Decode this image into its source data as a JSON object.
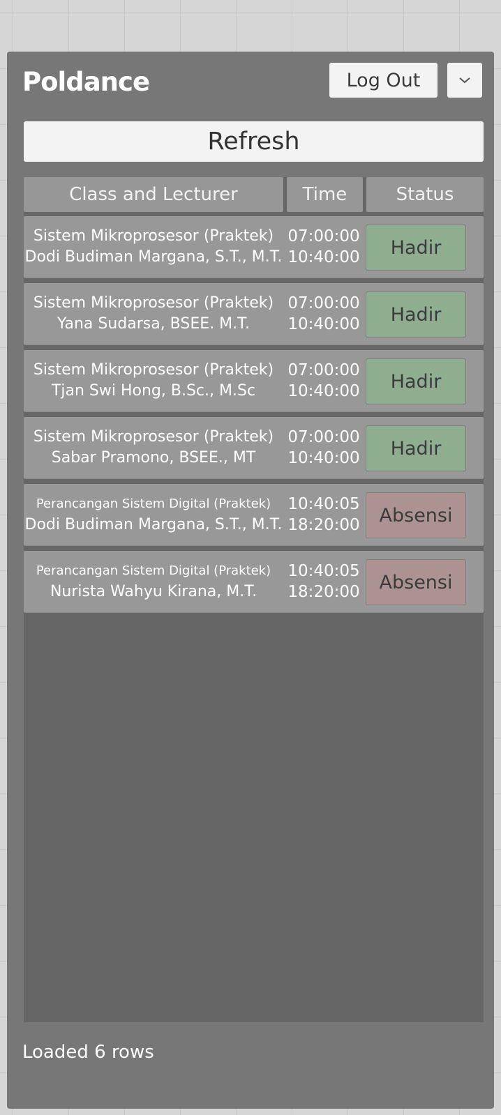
{
  "app": {
    "title": "Poldance"
  },
  "header": {
    "logout_label": "Log Out",
    "dropdown_icon": "chevron-down-icon"
  },
  "toolbar": {
    "refresh_label": "Refresh"
  },
  "table": {
    "columns": [
      "Class and Lecturer",
      "Time",
      "Status"
    ],
    "rows": [
      {
        "class": "Sistem Mikroprosesor (Praktek)",
        "lecturer": "Dodi Budiman Margana, S.T., M.T.",
        "start": "07:00:00",
        "end": "10:40:00",
        "status": "Hadir",
        "status_color": "#8fae8f"
      },
      {
        "class": "Sistem Mikroprosesor (Praktek)",
        "lecturer": "Yana Sudarsa, BSEE. M.T.",
        "start": "07:00:00",
        "end": "10:40:00",
        "status": "Hadir",
        "status_color": "#8fae8f"
      },
      {
        "class": "Sistem Mikroprosesor (Praktek)",
        "lecturer": "Tjan Swi Hong, B.Sc., M.Sc",
        "start": "07:00:00",
        "end": "10:40:00",
        "status": "Hadir",
        "status_color": "#8fae8f"
      },
      {
        "class": "Sistem Mikroprosesor (Praktek)",
        "lecturer": "Sabar Pramono, BSEE., MT",
        "start": "07:00:00",
        "end": "10:40:00",
        "status": "Hadir",
        "status_color": "#8fae8f"
      },
      {
        "class": "Perancangan Sistem Digital (Praktek)",
        "lecturer": "Dodi Budiman Margana, S.T., M.T.",
        "start": "10:40:05",
        "end": "18:20:00",
        "status": "Absensi",
        "status_color": "#ad9292"
      },
      {
        "class": "Perancangan Sistem Digital (Praktek)",
        "lecturer": "Nurista Wahyu Kirana, M.T.",
        "start": "10:40:05",
        "end": "18:20:00",
        "status": "Absensi",
        "status_color": "#ad9292"
      }
    ]
  },
  "footer": {
    "status_text": "Loaded 6 rows"
  }
}
